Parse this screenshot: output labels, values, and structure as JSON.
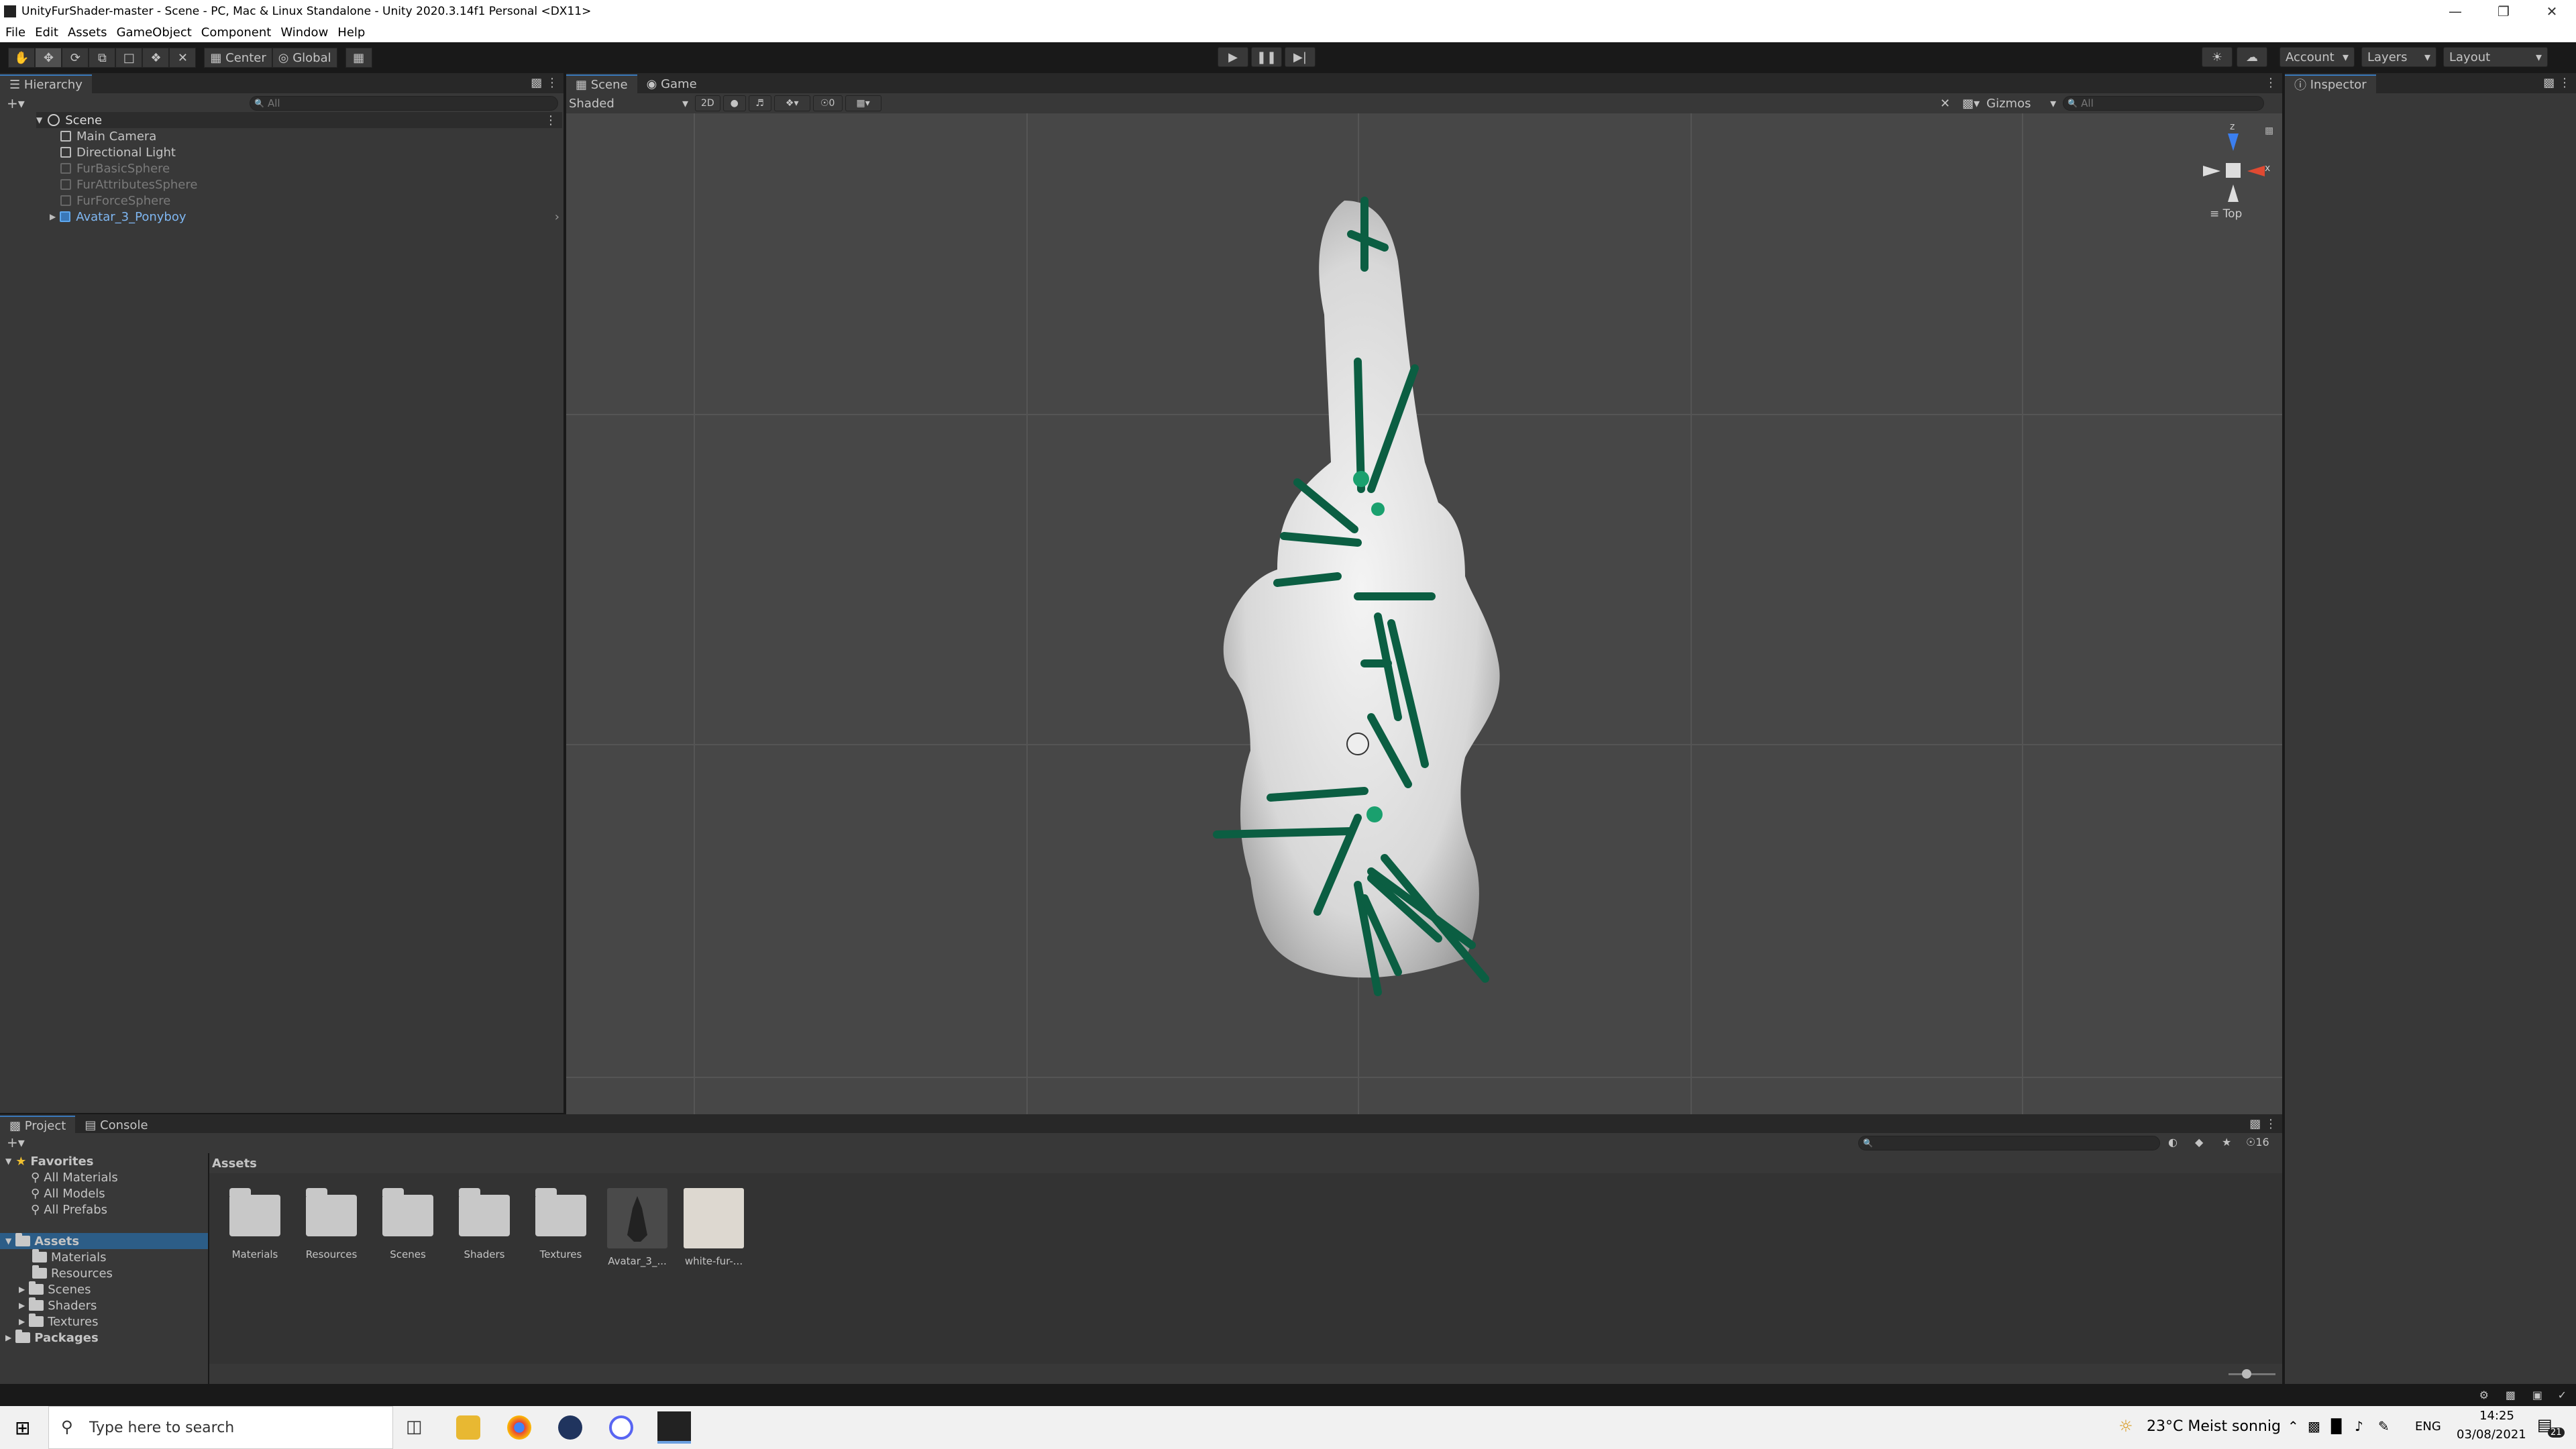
{
  "window": {
    "title": "UnityFurShader-master - Scene - PC, Mac & Linux Standalone - Unity 2020.3.14f1 Personal <DX11>"
  },
  "menu": [
    "File",
    "Edit",
    "Assets",
    "GameObject",
    "Component",
    "Window",
    "Help"
  ],
  "toolbar": {
    "pivot": "Center",
    "space": "Global",
    "account": "Account",
    "layers": "Layers",
    "layout": "Layout"
  },
  "hierarchy": {
    "tab": "Hierarchy",
    "search_placeholder": "All",
    "scene": "Scene",
    "items": [
      {
        "label": "Main Camera"
      },
      {
        "label": "Directional Light"
      },
      {
        "label": "FurBasicSphere"
      },
      {
        "label": "FurAttributesSphere"
      },
      {
        "label": "FurForceSphere"
      },
      {
        "label": "Avatar_3_Ponyboy"
      }
    ]
  },
  "scene_view": {
    "tabs": [
      "Scene",
      "Game"
    ],
    "shading": "Shaded",
    "mode_2d": "2D",
    "hidden_count": "0",
    "gizmos": "Gizmos",
    "search_placeholder": "All",
    "orientation": "Top",
    "axis_x": "x",
    "axis_z": "z"
  },
  "inspector": {
    "tab": "Inspector"
  },
  "project": {
    "tabs": [
      "Project",
      "Console"
    ],
    "hidden_count": "16",
    "favorites": {
      "label": "Favorites",
      "items": [
        "All Materials",
        "All Models",
        "All Prefabs"
      ]
    },
    "assets_tree": {
      "label": "Assets",
      "items": [
        "Materials",
        "Resources",
        "Scenes",
        "Shaders",
        "Textures"
      ]
    },
    "packages": "Packages",
    "breadcrumb": "Assets",
    "grid": [
      "Materials",
      "Resources",
      "Scenes",
      "Shaders",
      "Textures",
      "Avatar_3_...",
      "white-fur-..."
    ]
  },
  "taskbar": {
    "search_placeholder": "Type here to search",
    "weather": "23°C  Meist sonnig",
    "lang": "ENG",
    "time": "14:25",
    "date": "03/08/2021",
    "notifications": "21"
  }
}
